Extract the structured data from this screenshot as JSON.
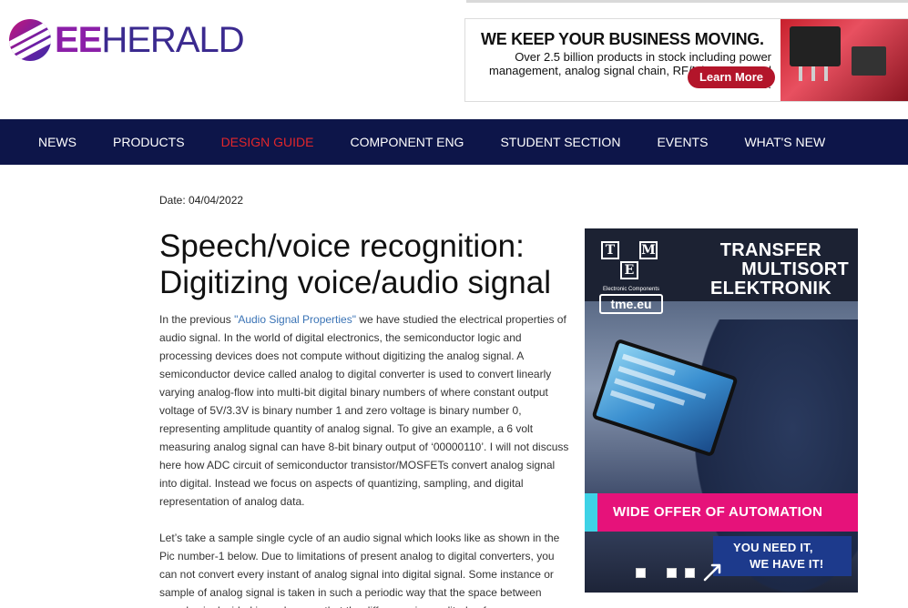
{
  "header": {
    "logo": {
      "ee": "EE",
      "herald": "HERALD",
      "icon": "eeherald-logo-icon"
    },
    "ad_banner": {
      "headline": "WE KEEP YOUR BUSINESS MOVING.",
      "body": "Over 2.5 billion products in stock including power management, analog signal chain, RF/Microwave and more!",
      "button_label": "Learn More",
      "accent_color": "#b3152a"
    }
  },
  "nav": {
    "items": [
      {
        "label": "NEWS",
        "active": false
      },
      {
        "label": "PRODUCTS",
        "active": false
      },
      {
        "label": "DESIGN GUIDE",
        "active": true
      },
      {
        "label": "COMPONENT ENG",
        "active": false
      },
      {
        "label": "STUDENT SECTION",
        "active": false
      },
      {
        "label": "EVENTS",
        "active": false
      },
      {
        "label": "WHAT'S NEW",
        "active": false
      }
    ],
    "background_color": "#0d1549",
    "active_color": "#e2262b"
  },
  "article": {
    "date": "Date: 04/04/2022",
    "title": "Speech/voice recognition: Digitizing voice/audio signal",
    "para1_pre": "In the previous ",
    "para1_link": "\"Audio Signal Properties\"",
    "para1_post": " we have studied the electrical properties of audio signal. In the world of digital electronics, the semiconductor logic and processing devices does not compute without digitizing the analog signal. A semiconductor device called analog to digital converter is used to convert linearly varying analog-flow into multi-bit digital binary numbers of where constant output voltage of 5V/3.3V is binary number 1 and zero voltage is binary number 0, representing amplitude quantity of analog signal. To give an example, a 6 volt measuring analog signal can have 8-bit binary output of ‘00000110’. I will not discuss here how ADC circuit of semiconductor transistor/MOSFETs convert analog signal into digital. Instead we focus on aspects of quantizing, sampling, and digital representation of analog data.",
    "para2": "Let’s take a sample single cycle of an audio signal which looks like as shown in the Pic number-1 below. Due to limitations of present analog to digital converters, you can not convert every instant of analog signal into digital signal. Some instance or sample of analog signal is taken in such a periodic way that the space between samples is decided in such a way that the difference in amplitude of"
  },
  "side_ad": {
    "logo_letters": [
      "T",
      "M",
      "E"
    ],
    "logo_sub": "Electronic Components",
    "logo_url": "tme.eu",
    "headline": [
      "TRANSFER",
      "MULTISORT",
      "ELEKTRONIK"
    ],
    "offer": "WIDE OFFER OF AUTOMATION",
    "tagline": [
      "YOU NEED IT,",
      "WE HAVE IT!"
    ],
    "offer_color": "#e6127a",
    "tagline_color": "#1d3a8c"
  }
}
